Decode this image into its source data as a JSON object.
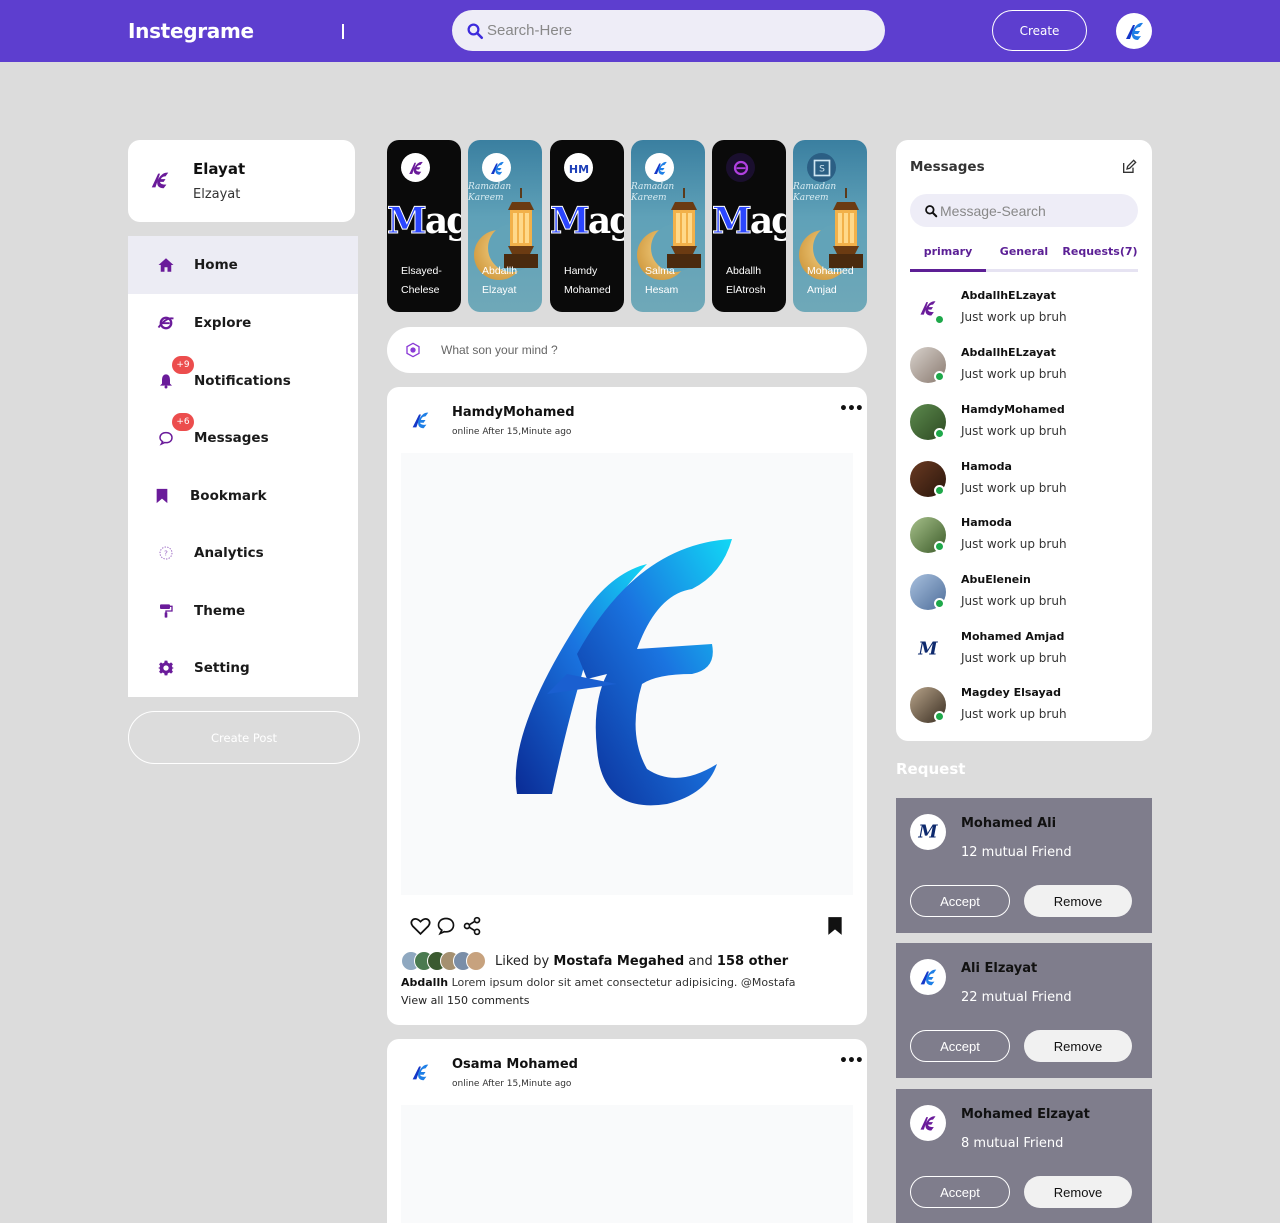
{
  "nav": {
    "logo": "Instegrame",
    "search_placeholder": "Search-Here",
    "create_label": "Create"
  },
  "profile": {
    "name": "Elayat",
    "handle": "Elzayat"
  },
  "sidebar": {
    "items": [
      {
        "label": "Home",
        "icon": "home-icon"
      },
      {
        "label": "Explore",
        "icon": "explore-icon"
      },
      {
        "label": "Notifications",
        "icon": "bell-icon",
        "badge": "+9"
      },
      {
        "label": "Messages",
        "icon": "chat-icon",
        "badge": "+6"
      },
      {
        "label": "Bookmark",
        "icon": "bookmark-icon"
      },
      {
        "label": "Analytics",
        "icon": "analytics-icon"
      },
      {
        "label": "Theme",
        "icon": "paint-roller-icon"
      },
      {
        "label": "Setting",
        "icon": "gear-icon"
      }
    ],
    "create_post_label": "Create Post"
  },
  "stories": [
    {
      "name1": "Elsayed-",
      "name2": "Chelese"
    },
    {
      "name1": "Abdallh",
      "name2": "Elzayat"
    },
    {
      "name1": "Hamdy",
      "name2": "Mohamed"
    },
    {
      "name1": "Salma",
      "name2": "Hesam"
    },
    {
      "name1": "Abdallh",
      "name2": "ElAtrosh"
    },
    {
      "name1": "Mohamed",
      "name2": "Amjad"
    }
  ],
  "story_art": {
    "magic": "Magic",
    "ramadan1": "Ramadan",
    "ramadan2": "Kareem"
  },
  "composer": {
    "placeholder": "What son your mind ?"
  },
  "posts": [
    {
      "author": "HamdyMohamed",
      "time": "online After 15,Minute ago",
      "liked_prefix": "Liked by",
      "liked_user": "Mostafa Megahed",
      "liked_and": "and",
      "liked_count": "158 other",
      "caption_user": "Abdallh",
      "caption_text": "Lorem ipsum dolor sit amet consectetur adipisicing. @Mostafa",
      "view_all": "View all 150 comments"
    },
    {
      "author": "Osama Mohamed",
      "time": "online After 15,Minute ago"
    }
  ],
  "messages": {
    "title": "Messages",
    "search_placeholder": "Message-Search",
    "tabs": [
      "primary",
      "General",
      "Requests(7)"
    ],
    "items": [
      {
        "name": "AbdallhELzayat",
        "text": "Just work up bruh"
      },
      {
        "name": "AbdallhELzayat",
        "text": "Just work up bruh"
      },
      {
        "name": "HamdyMohamed",
        "text": "Just work up bruh"
      },
      {
        "name": "Hamoda",
        "text": "Just work up bruh"
      },
      {
        "name": "Hamoda",
        "text": "Just work up bruh"
      },
      {
        "name": "AbuElenein",
        "text": "Just work up bruh"
      },
      {
        "name": "Mohamed Amjad",
        "text": "Just work up bruh"
      },
      {
        "name": "Magdey Elsayad",
        "text": "Just work up bruh"
      }
    ]
  },
  "requests": {
    "title": "Request",
    "accept_label": "Accept",
    "remove_label": "Remove",
    "items": [
      {
        "name": "Mohamed Ali",
        "mutual": "12 mutual Friend"
      },
      {
        "name": "Ali Elzayat",
        "mutual": "22 mutual Friend"
      },
      {
        "name": "Mohamed Elzayat",
        "mutual": "8 mutual Friend"
      }
    ]
  },
  "colors": {
    "brand": "#5d3ecf",
    "accent_purple": "#6a1b9a",
    "online": "#1ea84a",
    "badge": "#ec4d4d"
  }
}
